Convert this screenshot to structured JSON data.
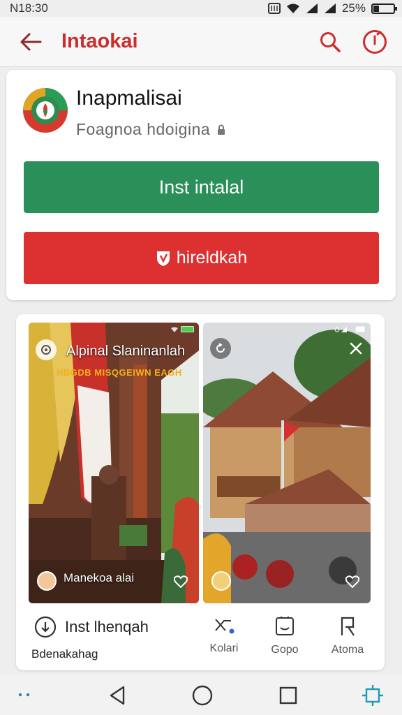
{
  "status_bar": {
    "time": "N18:30",
    "battery": "25%",
    "battery_level": 0.25
  },
  "app_bar": {
    "title": "Intaokai"
  },
  "app_info": {
    "name": "Inapmalisai",
    "developer": "Foagnoa hdoigina",
    "install_label": "Inst intalal",
    "secondary_label": "hireldkah"
  },
  "screenshots": [
    {
      "title": "Alpinal Slaninanlah",
      "subtitle": "HBGDB MISQGEIWN EAGH",
      "caption": "Manekoa alai"
    },
    {
      "caption": ""
    }
  ],
  "actions": {
    "main_label": "Inst lhenqah",
    "main_sub": "Bdenakahag",
    "items": [
      {
        "label": "Kolari",
        "icon": "share-icon"
      },
      {
        "label": "Gopo",
        "icon": "chat-icon"
      },
      {
        "label": "Atoma",
        "icon": "bookmark-icon"
      }
    ]
  },
  "colors": {
    "accent": "#cc2d2d",
    "install": "#2a8f58",
    "secondary": "#dd3030"
  }
}
